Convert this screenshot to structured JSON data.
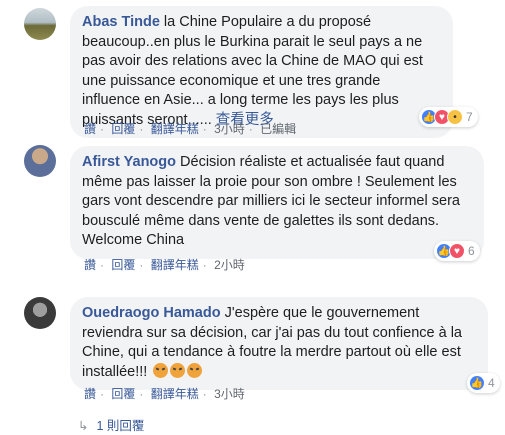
{
  "comments": [
    {
      "author": "Abas Tinde",
      "body": "la Chine Populaire a du proposé beaucoup..en plus le Burkina parait le seul pays a ne pas avoir des relations avec la Chine de MAO qui est une puissance economique et une tres grande influence en Asie... a long terme les pays les plus puissants seront......",
      "see_more": "查看更多",
      "actions": [
        "讚",
        "回覆",
        "翻譯年糕",
        "3小時",
        "已編輯"
      ],
      "reaction_count": "7"
    },
    {
      "author": "Afirst Yanogo",
      "body": "Décision réaliste et actualisée faut quand même pas laisser la proie pour son ombre ! Seulement les gars vont descendre par milliers ici le secteur informel sera bousculé même dans vente de galettes ils sont dedans. Welcome China",
      "actions": [
        "讚",
        "回覆",
        "翻譯年糕",
        "2小時"
      ],
      "reaction_count": "6"
    },
    {
      "author": "Ouedraogo Hamado",
      "body": "J'espère que le gouvernement reviendra sur sa décision, car j'ai pas du tout confience à la Chine, qui a tendance à foutre la merdre partout où elle est installée!!!",
      "actions": [
        "讚",
        "回覆",
        "翻譯年糕",
        "3小時"
      ],
      "reaction_count": "4"
    }
  ],
  "replies_label": "1 則回覆",
  "colors": {
    "link": "#385898",
    "bubble": "#f2f3f5",
    "meta": "#616770",
    "like": "#4080ff",
    "love": "#f25268"
  }
}
